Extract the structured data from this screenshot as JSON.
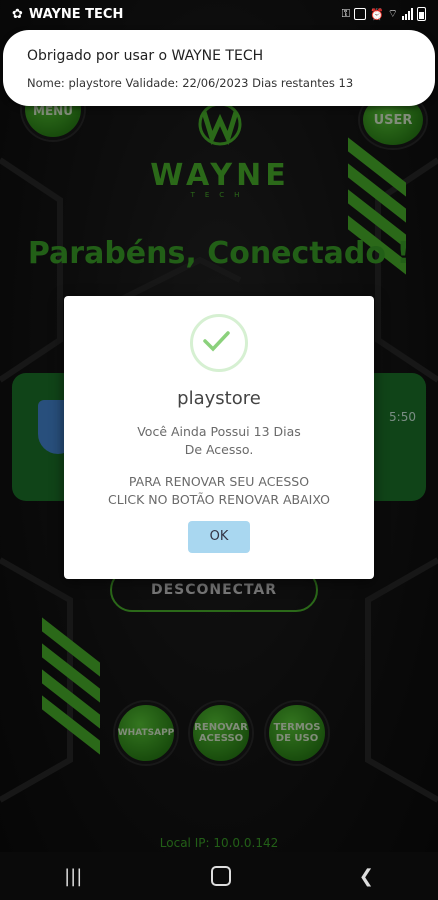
{
  "status_bar": {
    "app_name": "WAYNE TECH"
  },
  "notification": {
    "line1": "Obrigado por usar o WAYNE TECH",
    "line2": "Nome: playstore  Validade:  22/06/2023 Dias restantes  13"
  },
  "header": {
    "menu_label": "MENU",
    "user_label": "USER",
    "logo_name": "WAYNE",
    "logo_sub": "TECH"
  },
  "main": {
    "congrats": "Parabéns, Conectado !",
    "card_text": "5:50",
    "disconnect_label": "DESCONECTAR",
    "local_ip": "Local IP: 10.0.0.142"
  },
  "bottom_buttons": {
    "whatsapp": "WHATSAPP",
    "renovar": "RENOVAR ACESSO",
    "termos": "TERMOS DE USO"
  },
  "dialog": {
    "title": "playstore",
    "msg_line1": "Você Ainda Possui 13 Dias",
    "msg_line2": "De Acesso.",
    "msg_line3": "PARA RENOVAR SEU ACESSO",
    "msg_line4": "CLICK NO BOTÃO RENOVAR ABAIXO",
    "ok_label": "OK"
  },
  "colors": {
    "accent": "#4fbf2f",
    "card": "#1e7d2c",
    "ok_button": "#a9d7f0"
  }
}
